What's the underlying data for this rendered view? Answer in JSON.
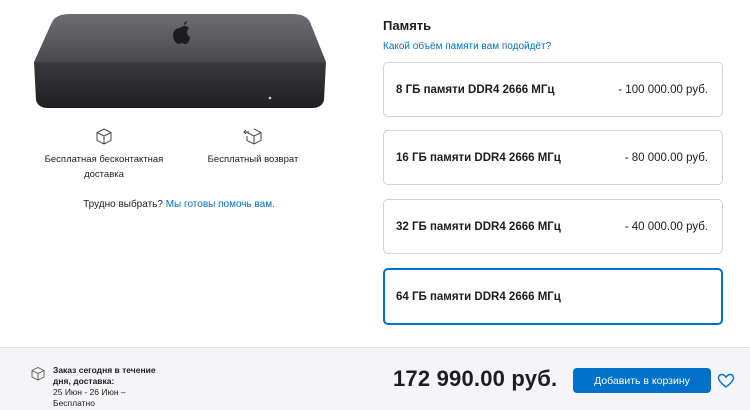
{
  "product": {
    "image_icon": "mac-mini-image"
  },
  "services": {
    "shipping_line1": "Бесплатная бесконтактная",
    "shipping_line2": "доставка",
    "shipping_icon": "box-icon",
    "returns": "Бесплатный возврат",
    "returns_icon": "box-return-icon"
  },
  "help": {
    "text": "Трудно выбрать?",
    "link": "Мы готовы помочь вам."
  },
  "memory": {
    "title": "Память",
    "link": "Какой объём памяти вам подойдёт?",
    "options": [
      {
        "name": "8 ГБ памяти DDR4 2666 МГц",
        "price": "- 100 000.00 руб."
      },
      {
        "name": "16 ГБ памяти DDR4 2666 МГц",
        "price": "- 80 000.00 руб."
      },
      {
        "name": "32 ГБ памяти DDR4 2666 МГц",
        "price": "- 40 000.00 руб."
      },
      {
        "name": "64 ГБ памяти DDR4 2666 МГц",
        "price": ""
      }
    ],
    "selected_index": 3
  },
  "footer": {
    "delivery_line1": "Заказ сегодня в течение",
    "delivery_line2": "дня, доставка:",
    "delivery_line3": "25 Июн - 26 Июн –",
    "delivery_line4": "Бесплатно",
    "total": "172 990.00 руб.",
    "add_to_cart": "Добавить в корзину",
    "favorite_icon": "heart-icon"
  },
  "colors": {
    "accent": "#0070c9",
    "footer_bg": "#f5f5f7",
    "border": "#d2d2d7"
  }
}
